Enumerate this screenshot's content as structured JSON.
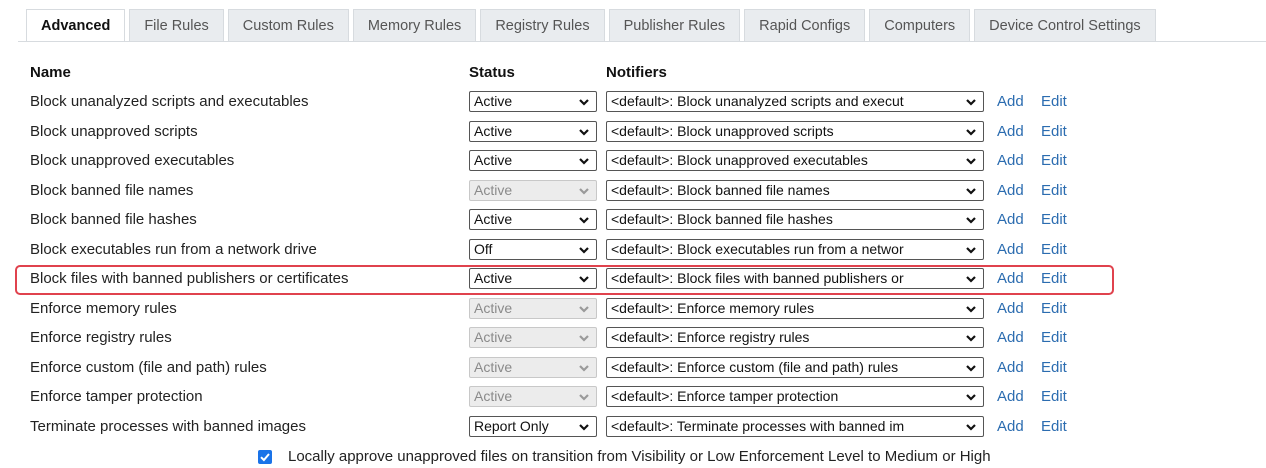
{
  "tabs": [
    {
      "label": "Advanced",
      "active": true
    },
    {
      "label": "File Rules",
      "active": false
    },
    {
      "label": "Custom Rules",
      "active": false
    },
    {
      "label": "Memory Rules",
      "active": false
    },
    {
      "label": "Registry Rules",
      "active": false
    },
    {
      "label": "Publisher Rules",
      "active": false
    },
    {
      "label": "Rapid Configs",
      "active": false
    },
    {
      "label": "Computers",
      "active": false
    },
    {
      "label": "Device Control Settings",
      "active": false
    }
  ],
  "headers": {
    "name": "Name",
    "status": "Status",
    "notifiers": "Notifiers"
  },
  "links": {
    "add": "Add",
    "edit": "Edit"
  },
  "rows": [
    {
      "name": "Block unanalyzed scripts and executables",
      "status": "Active",
      "status_disabled": false,
      "notifier": "<default>: Block unanalyzed scripts and execut"
    },
    {
      "name": "Block unapproved scripts",
      "status": "Active",
      "status_disabled": false,
      "notifier": "<default>: Block unapproved scripts"
    },
    {
      "name": "Block unapproved executables",
      "status": "Active",
      "status_disabled": false,
      "notifier": "<default>: Block unapproved executables"
    },
    {
      "name": "Block banned file names",
      "status": "Active",
      "status_disabled": true,
      "notifier": "<default>: Block banned file names"
    },
    {
      "name": "Block banned file hashes",
      "status": "Active",
      "status_disabled": false,
      "notifier": "<default>: Block banned file hashes"
    },
    {
      "name": "Block executables run from a network drive",
      "status": "Off",
      "status_disabled": false,
      "notifier": "<default>: Block executables run from a networ"
    },
    {
      "name": "Block files with banned publishers or certificates",
      "status": "Active",
      "status_disabled": false,
      "notifier": "<default>: Block files with banned publishers or",
      "highlighted": true
    },
    {
      "name": "Enforce memory rules",
      "status": "Active",
      "status_disabled": true,
      "notifier": "<default>: Enforce memory rules"
    },
    {
      "name": "Enforce registry rules",
      "status": "Active",
      "status_disabled": true,
      "notifier": "<default>: Enforce registry rules"
    },
    {
      "name": "Enforce custom (file and path) rules",
      "status": "Active",
      "status_disabled": true,
      "notifier": "<default>: Enforce custom (file and path) rules"
    },
    {
      "name": "Enforce tamper protection",
      "status": "Active",
      "status_disabled": true,
      "notifier": "<default>: Enforce tamper protection"
    },
    {
      "name": "Terminate processes with banned images",
      "status": "Report Only",
      "status_disabled": false,
      "notifier": "<default>: Terminate processes with banned im"
    }
  ],
  "footer": {
    "checked": true,
    "label": "Locally approve unapproved files on transition from Visibility or Low Enforcement Level to Medium or High"
  },
  "colors": {
    "accent": "#1a73e8",
    "link": "#2b6cb0",
    "highlight": "#e0424d"
  },
  "icons": {
    "dropdown": "chevron-down-icon",
    "checkbox": "checkmark-icon"
  }
}
